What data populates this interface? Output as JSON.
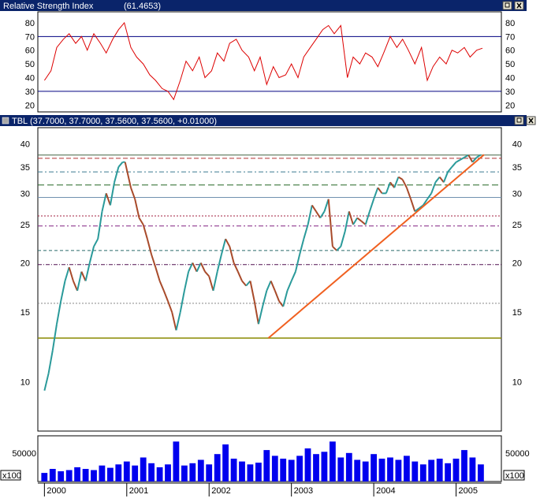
{
  "rsi_panel": {
    "title": "Relative Strength Index",
    "value": "(61.4653)",
    "value_color": "#ff2020",
    "yticks": [
      20,
      30,
      40,
      50,
      60,
      70,
      80
    ],
    "levels": [
      70,
      30
    ],
    "line_color": "#dd0000"
  },
  "price_panel": {
    "title": "TBL",
    "values": "(37.7000, 37.7000, 37.5600, 37.5600, +0.01000)",
    "values_color": "#40c8ff",
    "yticks": [
      10,
      15,
      20,
      25,
      30,
      35,
      40
    ]
  },
  "volume_panel": {
    "tick": "50000",
    "multiplier": "x100",
    "bar_color": "#0000ee"
  },
  "x_axis": {
    "years": [
      "2000",
      "2001",
      "2002",
      "2003",
      "2004",
      "2005"
    ]
  },
  "icons": [
    "restore-icon",
    "close-icon"
  ],
  "chart_data": [
    {
      "type": "line",
      "title": "Relative Strength Index",
      "annotation": "(61.4653)",
      "ylim": [
        15,
        88
      ],
      "levels": [
        70,
        30
      ],
      "x": [
        2000.0,
        2000.08,
        2000.15,
        2000.23,
        2000.3,
        2000.38,
        2000.45,
        2000.52,
        2000.6,
        2000.68,
        2000.75,
        2000.83,
        2000.9,
        2000.97,
        2001.05,
        2001.12,
        2001.2,
        2001.28,
        2001.35,
        2001.43,
        2001.5,
        2001.57,
        2001.65,
        2001.72,
        2001.8,
        2001.88,
        2001.95,
        2002.03,
        2002.1,
        2002.18,
        2002.25,
        2002.33,
        2002.4,
        2002.48,
        2002.55,
        2002.62,
        2002.7,
        2002.78,
        2002.85,
        2002.93,
        2003.0,
        2003.08,
        2003.15,
        2003.23,
        2003.3,
        2003.38,
        2003.45,
        2003.52,
        2003.6,
        2003.68,
        2003.75,
        2003.83,
        2003.9,
        2003.98,
        2004.05,
        2004.12,
        2004.2,
        2004.28,
        2004.35,
        2004.42,
        2004.5,
        2004.58,
        2004.65,
        2004.72,
        2004.8,
        2004.88,
        2004.95,
        2005.02,
        2005.1,
        2005.17,
        2005.25,
        2005.32
      ],
      "values": [
        38,
        45,
        62,
        68,
        72,
        65,
        70,
        60,
        72,
        65,
        58,
        68,
        75,
        80,
        62,
        55,
        50,
        42,
        38,
        32,
        30,
        24,
        38,
        52,
        45,
        55,
        40,
        45,
        58,
        52,
        65,
        68,
        60,
        55,
        45,
        55,
        35,
        48,
        40,
        42,
        50,
        40,
        55,
        62,
        68,
        75,
        78,
        72,
        78,
        40,
        55,
        50,
        58,
        55,
        48,
        58,
        70,
        62,
        68,
        60,
        50,
        62,
        38,
        48,
        55,
        50,
        60,
        58,
        62,
        55,
        60,
        61.47
      ],
      "xticks": [
        "2000",
        "2001",
        "2002",
        "2003",
        "2004",
        "2005"
      ]
    },
    {
      "type": "line",
      "title": "TBL",
      "annotation": "(37.7000, 37.7000, 37.5600, 37.5600, +0.01000)",
      "scale": "log",
      "ylim": [
        7.5,
        44
      ],
      "x": [
        2000.0,
        2000.05,
        2000.1,
        2000.15,
        2000.2,
        2000.25,
        2000.3,
        2000.35,
        2000.4,
        2000.45,
        2000.5,
        2000.55,
        2000.6,
        2000.65,
        2000.7,
        2000.75,
        2000.8,
        2000.85,
        2000.9,
        2000.95,
        2000.98,
        2001.05,
        2001.1,
        2001.15,
        2001.2,
        2001.25,
        2001.3,
        2001.35,
        2001.4,
        2001.45,
        2001.5,
        2001.55,
        2001.6,
        2001.65,
        2001.7,
        2001.75,
        2001.8,
        2001.85,
        2001.9,
        2001.95,
        2002.0,
        2002.05,
        2002.1,
        2002.15,
        2002.2,
        2002.25,
        2002.3,
        2002.35,
        2002.4,
        2002.45,
        2002.5,
        2002.55,
        2002.6,
        2002.65,
        2002.7,
        2002.75,
        2002.8,
        2002.85,
        2002.9,
        2002.95,
        2003.0,
        2003.05,
        2003.1,
        2003.15,
        2003.2,
        2003.25,
        2003.3,
        2003.35,
        2003.4,
        2003.45,
        2003.5,
        2003.55,
        2003.6,
        2003.65,
        2003.7,
        2003.75,
        2003.8,
        2003.85,
        2003.9,
        2003.95,
        2004.0,
        2004.05,
        2004.1,
        2004.15,
        2004.2,
        2004.25,
        2004.3,
        2004.35,
        2004.4,
        2004.45,
        2004.5,
        2004.55,
        2004.6,
        2004.65,
        2004.7,
        2004.75,
        2004.8,
        2004.85,
        2004.9,
        2004.95,
        2005.0,
        2005.05,
        2005.1,
        2005.15,
        2005.2,
        2005.25,
        2005.3
      ],
      "values": [
        9.5,
        10.5,
        12,
        14,
        16,
        18,
        19.5,
        18,
        17,
        19,
        18,
        20,
        22,
        23,
        27,
        30,
        28,
        32,
        35,
        36,
        36,
        31,
        29,
        26,
        25,
        23,
        21,
        19.5,
        18,
        17,
        16,
        15,
        13.5,
        15,
        17,
        19,
        20,
        19,
        20,
        19,
        18.5,
        17,
        19,
        21,
        23,
        22,
        20,
        19,
        18,
        17.5,
        18,
        16,
        14,
        15.5,
        17,
        18,
        17,
        16,
        15.5,
        17,
        18,
        19,
        21,
        23,
        25,
        28,
        27,
        26,
        27,
        29,
        22,
        21.5,
        22,
        24,
        27,
        25,
        26,
        25.5,
        25,
        27,
        29,
        31,
        30,
        30,
        32,
        31,
        33,
        32.5,
        31,
        29,
        27,
        27.5,
        28,
        29,
        30,
        32,
        33,
        32,
        34,
        35,
        36,
        36.5,
        37,
        37.5,
        36,
        37,
        37.56
      ],
      "hlines": [
        37.5,
        36.8,
        34,
        31.5,
        29.3,
        26.3,
        24.8,
        21.5,
        19.8,
        15.8,
        12.9
      ],
      "trendline": [
        [
          2002.72,
          12.9
        ],
        [
          2005.34,
          37.6
        ]
      ],
      "xticks": [
        "2000",
        "2001",
        "2002",
        "2003",
        "2004",
        "2005"
      ]
    },
    {
      "type": "bar",
      "title": "",
      "units": "x100",
      "yticks": [
        50000
      ],
      "ylim": [
        0,
        80000
      ],
      "x": [
        2000.0,
        2000.1,
        2000.2,
        2000.3,
        2000.4,
        2000.5,
        2000.6,
        2000.7,
        2000.8,
        2000.9,
        2001.0,
        2001.1,
        2001.2,
        2001.3,
        2001.4,
        2001.5,
        2001.6,
        2001.7,
        2001.8,
        2001.9,
        2002.0,
        2002.1,
        2002.2,
        2002.3,
        2002.4,
        2002.5,
        2002.6,
        2002.7,
        2002.8,
        2002.9,
        2003.0,
        2003.1,
        2003.2,
        2003.3,
        2003.4,
        2003.5,
        2003.6,
        2003.7,
        2003.8,
        2003.9,
        2004.0,
        2004.1,
        2004.2,
        2004.3,
        2004.4,
        2004.5,
        2004.6,
        2004.7,
        2004.8,
        2004.9,
        2005.0,
        2005.1,
        2005.2,
        2005.3
      ],
      "values": [
        15000,
        22000,
        18000,
        20000,
        25000,
        22000,
        20000,
        28000,
        24000,
        30000,
        35000,
        28000,
        42000,
        32000,
        25000,
        30000,
        70000,
        28000,
        32000,
        38000,
        30000,
        48000,
        65000,
        40000,
        35000,
        30000,
        33000,
        55000,
        45000,
        40000,
        38000,
        45000,
        58000,
        48000,
        52000,
        70000,
        42000,
        50000,
        38000,
        35000,
        48000,
        40000,
        42000,
        38000,
        45000,
        35000,
        30000,
        38000,
        40000,
        32000,
        40000,
        55000,
        42000,
        30000
      ]
    }
  ]
}
